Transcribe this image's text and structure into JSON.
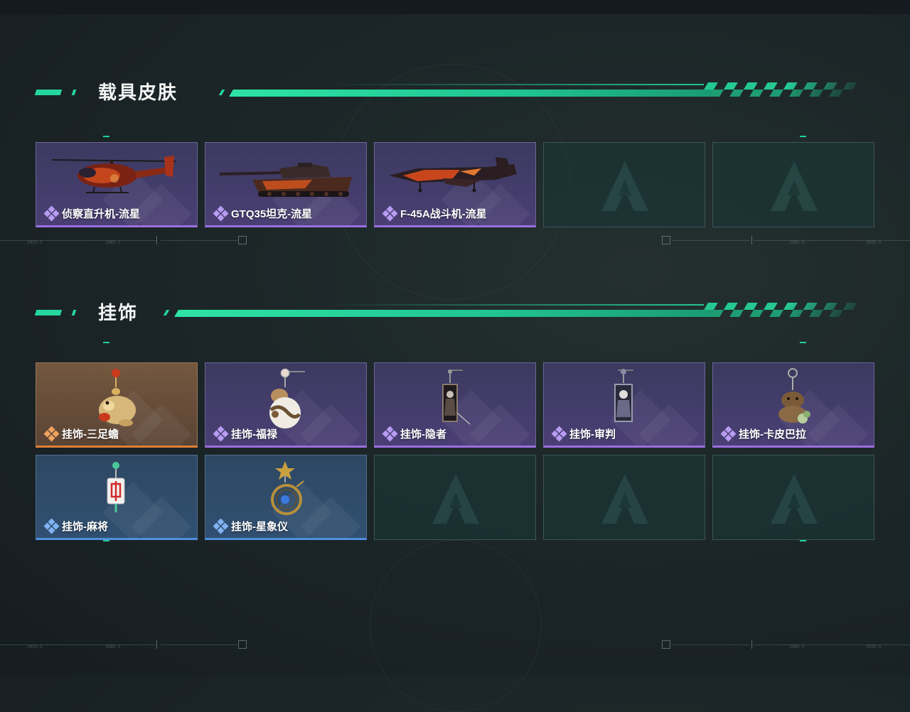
{
  "sections": [
    {
      "title": "载具皮肤",
      "items": [
        {
          "name": "侦察直升机-流星",
          "rarity": "purple",
          "icon": "helicopter-icon"
        },
        {
          "name": "GTQ35坦克-流星",
          "rarity": "purple",
          "icon": "tank-icon"
        },
        {
          "name": "F-45A战斗机-流星",
          "rarity": "purple",
          "icon": "fighter-jet-icon"
        },
        {
          "name": "",
          "rarity": "empty",
          "icon": "empty-slot-logo-icon"
        },
        {
          "name": "",
          "rarity": "empty",
          "icon": "empty-slot-logo-icon"
        }
      ]
    },
    {
      "title": "挂饰",
      "items": [
        {
          "name": "挂饰-三足蟾",
          "rarity": "orange",
          "icon": "three-legged-toad-charm-icon"
        },
        {
          "name": "挂饰-福禄",
          "rarity": "purple",
          "icon": "gourd-charm-icon"
        },
        {
          "name": "挂饰-隐者",
          "rarity": "purple",
          "icon": "hermit-card-charm-icon"
        },
        {
          "name": "挂饰-审判",
          "rarity": "purple",
          "icon": "judgement-card-charm-icon"
        },
        {
          "name": "挂饰-卡皮巴拉",
          "rarity": "purple",
          "icon": "capybara-charm-icon"
        },
        {
          "name": "挂饰-麻将",
          "rarity": "blue",
          "icon": "mahjong-tile-charm-icon"
        },
        {
          "name": "挂饰-星象仪",
          "rarity": "blue",
          "icon": "astrolabe-charm-icon"
        },
        {
          "name": "",
          "rarity": "empty",
          "icon": "empty-slot-logo-icon"
        },
        {
          "name": "",
          "rarity": "empty",
          "icon": "empty-slot-logo-icon"
        },
        {
          "name": "",
          "rarity": "empty",
          "icon": "empty-slot-logo-icon"
        }
      ]
    }
  ],
  "hud_numbers": [
    "2035-5",
    "1985-3"
  ],
  "colors": {
    "accent_green": "#25d69c",
    "rarity_purple": "#9b6fe0",
    "rarity_orange": "#e07f34",
    "rarity_blue": "#4f8fe0",
    "empty_slot": "#1a3838"
  }
}
